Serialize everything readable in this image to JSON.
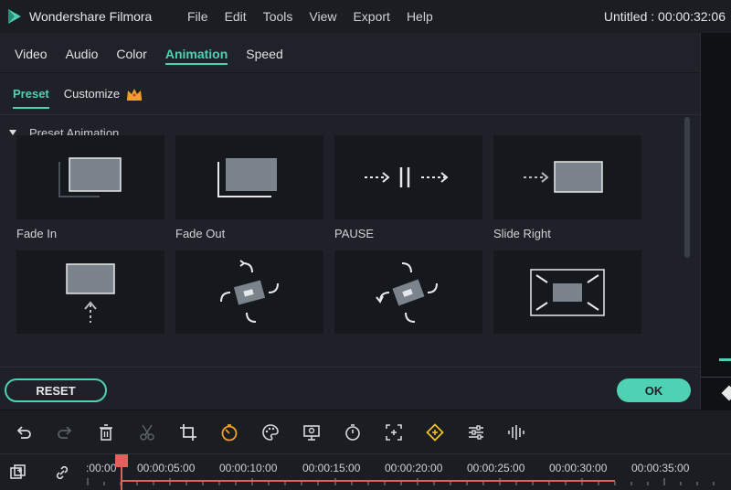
{
  "app": {
    "name": "Wondershare Filmora",
    "project_title": "Untitled : 00:00:32:06"
  },
  "menu": [
    "File",
    "Edit",
    "Tools",
    "View",
    "Export",
    "Help"
  ],
  "tabs": [
    {
      "label": "Video",
      "active": false
    },
    {
      "label": "Audio",
      "active": false
    },
    {
      "label": "Color",
      "active": false
    },
    {
      "label": "Animation",
      "active": true
    },
    {
      "label": "Speed",
      "active": false
    }
  ],
  "subtabs": [
    {
      "label": "Preset",
      "active": true
    },
    {
      "label": "Customize",
      "active": false,
      "icon": "crown-icon"
    }
  ],
  "section": {
    "title": "Preset Animation"
  },
  "presets": [
    {
      "label": "Fade In",
      "icon": "fade-in-thumb"
    },
    {
      "label": "Fade Out",
      "icon": "fade-out-thumb"
    },
    {
      "label": "PAUSE",
      "icon": "pause-thumb"
    },
    {
      "label": "Slide Right",
      "icon": "slide-right-thumb"
    },
    {
      "label": "",
      "icon": "slide-up-thumb"
    },
    {
      "label": "",
      "icon": "rotate-cw-thumb"
    },
    {
      "label": "",
      "icon": "rotate-ccw-thumb"
    },
    {
      "label": "",
      "icon": "zoom-out-thumb"
    }
  ],
  "buttons": {
    "reset": "RESET",
    "ok": "OK"
  },
  "toolbar": [
    "undo-icon",
    "redo-icon",
    "delete-icon",
    "cut-icon",
    "crop-icon",
    "speed-icon",
    "color-palette-icon",
    "green-screen-icon",
    "duration-icon",
    "zoom-fit-icon",
    "keyframe-icon",
    "audio-adjust-icon",
    "audio-waveform-icon"
  ],
  "timeline": {
    "ticks": [
      ":00:00",
      "00:00:05:00",
      "00:00:10:00",
      "00:00:15:00",
      "00:00:20:00",
      "00:00:25:00",
      "00:00:30:00",
      "00:00:35:00"
    ]
  },
  "colors": {
    "accent": "#4fd1b3",
    "playhead": "#e0625a",
    "background": "#1e2127"
  }
}
